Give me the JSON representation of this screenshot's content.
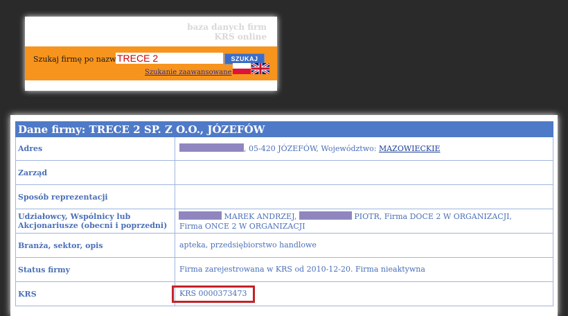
{
  "brand": {
    "line1": "baza danych firm",
    "line2": "KRS online"
  },
  "search": {
    "label": "Szukaj firmę po nazwie",
    "value": "TRECE 2",
    "button_label": "SZUKAJ",
    "advanced_link": "Szukanie zaawansowane"
  },
  "company": {
    "title": "Dane firmy: TRECE 2 SP. Z O.O., JÓZEFÓW",
    "rows": {
      "address": {
        "label": "Adres",
        "text": ", 05-420 JÓZEFÓW, Województwo:",
        "voivodeship": "MAZOWIECKIE"
      },
      "board": {
        "label": "Zarząd"
      },
      "representation": {
        "label": "Sposób reprezentacji"
      },
      "shareholders": {
        "label": "Udziałowcy, Wspólnicy lub Akcjonariusze (obecni i poprzedni)",
        "person1": "MAREK ANDRZEJ,",
        "person2_and_firm1": "PIOTR, Firma DOCE 2 W ORGANIZACJI,",
        "firm2": "Firma ONCE 2 W ORGANIZACJI"
      },
      "industry": {
        "label": "Branża, sektor, opis",
        "value": "apteka, przedsiębiorstwo handlowe"
      },
      "status": {
        "label": "Status firmy",
        "value": "Firma zarejestrowana w KRS od 2010-12-20. Firma nieaktywna"
      },
      "krs": {
        "label": "KRS",
        "value": "KRS 0000373473"
      }
    }
  },
  "colors": {
    "background": "#2a2a2a",
    "orange": "#f7941d",
    "header_blue": "#4f7ac7",
    "text_blue": "#4a6fb8",
    "highlight_red": "#c42226",
    "redaction": "#8f86c0"
  }
}
